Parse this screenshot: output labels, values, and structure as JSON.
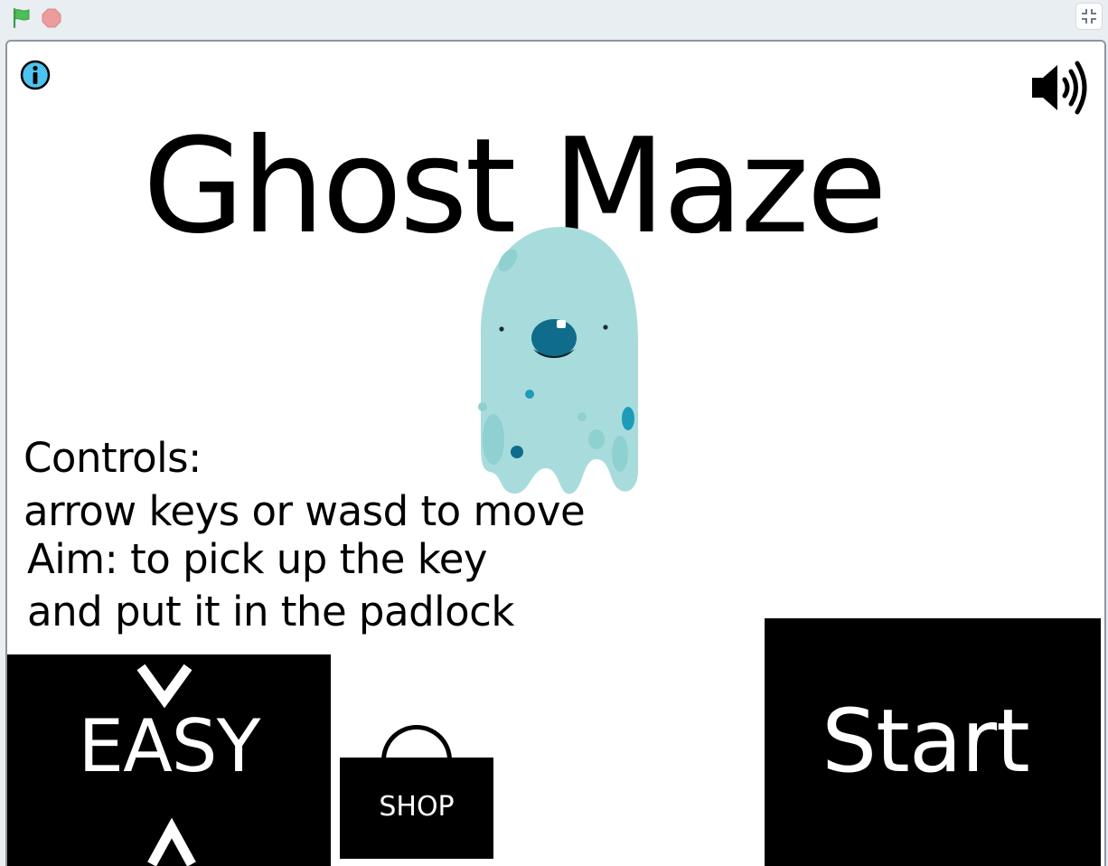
{
  "toolbar": {
    "green_flag_icon": "green-flag-icon",
    "stop_icon": "stop-sign-icon",
    "fullscreen_icon": "exit-fullscreen-icon"
  },
  "stage": {
    "title": "Ghost Maze",
    "controls_heading": "Controls:",
    "controls_text": "arrow keys or wasd to move",
    "aim_line1": "Aim: to pick up the key",
    "aim_line2": "and put it in the padlock",
    "difficulty": "EASY",
    "shop_label": "SHOP",
    "start_label": "Start"
  },
  "colors": {
    "flag_green": "#4cbf56",
    "stop_red": "#ec9c9c",
    "info_blue": "#4dc3f0",
    "ghost_body": "#a8dcdc",
    "ghost_spot": "#1e9bb8"
  }
}
